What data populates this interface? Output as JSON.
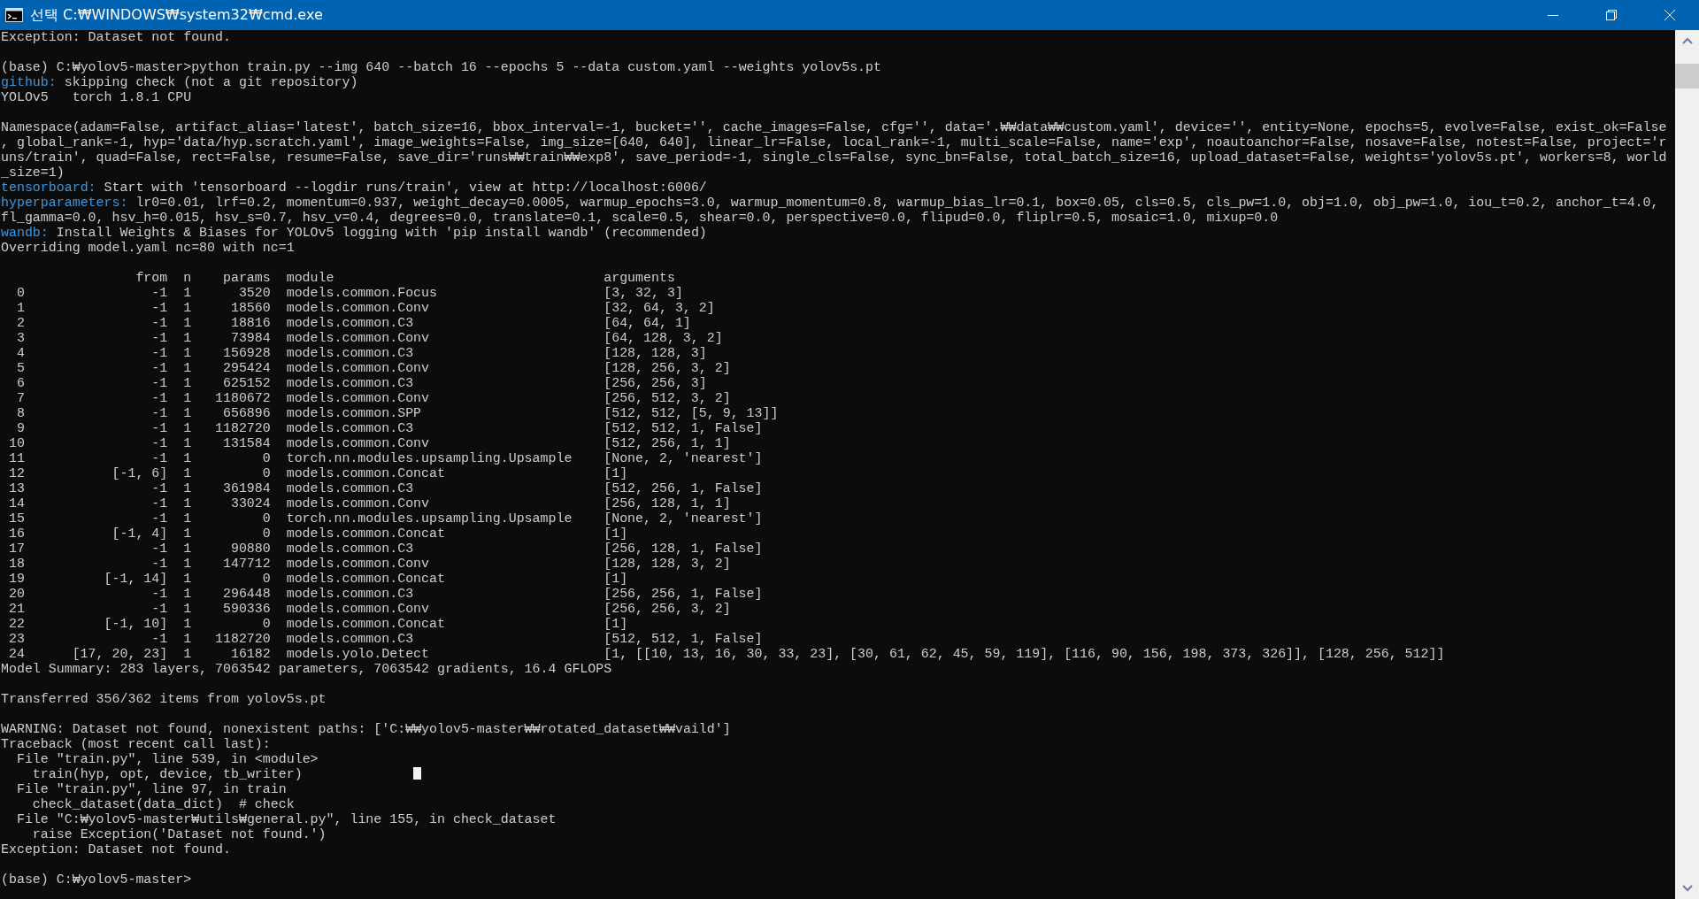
{
  "window": {
    "title": "선택 C:₩WINDOWS₩system32₩cmd.exe"
  },
  "console": {
    "lines": [
      {
        "kind": "text",
        "text": "Exception: Dataset not found."
      },
      {
        "kind": "blank"
      },
      {
        "kind": "text",
        "text": "(base) C:₩yolov5-master>python train.py --img 640 --batch 16 --epochs 5 --data custom.yaml --weights yolov5s.pt"
      },
      {
        "kind": "tagged",
        "tag": "github:",
        "text": "skipping check (not a git repository)"
      },
      {
        "kind": "text",
        "text": "YOLOv5   torch 1.8.1 CPU"
      },
      {
        "kind": "blank"
      },
      {
        "kind": "text",
        "text": "Namespace(adam=False, artifact_alias='latest', batch_size=16, bbox_interval=-1, bucket='', cache_images=False, cfg='', data='.₩₩data₩₩custom.yaml', device='', entity=None, epochs=5, evolve=False, exist_ok=False"
      },
      {
        "kind": "text",
        "text": ", global_rank=-1, hyp='data/hyp.scratch.yaml', image_weights=False, img_size=[640, 640], linear_lr=False, local_rank=-1, multi_scale=False, name='exp', noautoanchor=False, nosave=False, notest=False, project='r"
      },
      {
        "kind": "text",
        "text": "uns/train', quad=False, rect=False, resume=False, save_dir='runs₩₩train₩₩exp8', save_period=-1, single_cls=False, sync_bn=False, total_batch_size=16, upload_dataset=False, weights='yolov5s.pt', workers=8, world"
      },
      {
        "kind": "text",
        "text": "_size=1)"
      },
      {
        "kind": "tagged",
        "tag": "tensorboard:",
        "text": "Start with 'tensorboard --logdir runs/train', view at http://localhost:6006/"
      },
      {
        "kind": "tagged",
        "tag": "hyperparameters:",
        "text": "lr0=0.01, lrf=0.2, momentum=0.937, weight_decay=0.0005, warmup_epochs=3.0, warmup_momentum=0.8, warmup_bias_lr=0.1, box=0.05, cls=0.5, cls_pw=1.0, obj=1.0, obj_pw=1.0, iou_t=0.2, anchor_t=4.0,"
      },
      {
        "kind": "text",
        "text": "fl_gamma=0.0, hsv_h=0.015, hsv_s=0.7, hsv_v=0.4, degrees=0.0, translate=0.1, scale=0.5, shear=0.0, perspective=0.0, flipud=0.0, fliplr=0.5, mosaic=1.0, mixup=0.0"
      },
      {
        "kind": "tagged",
        "tag": "wandb:",
        "text": "Install Weights & Biases for YOLOv5 logging with 'pip install wandb' (recommended)"
      },
      {
        "kind": "text",
        "text": "Overriding model.yaml nc=80 with nc=1"
      },
      {
        "kind": "blank"
      },
      {
        "kind": "table",
        "columns": [
          "",
          "from",
          "n",
          "params",
          "module",
          "arguments"
        ],
        "rows": [
          [
            "0",
            "-1",
            "1",
            "3520",
            "models.common.Focus",
            "[3, 32, 3]"
          ],
          [
            "1",
            "-1",
            "1",
            "18560",
            "models.common.Conv",
            "[32, 64, 3, 2]"
          ],
          [
            "2",
            "-1",
            "1",
            "18816",
            "models.common.C3",
            "[64, 64, 1]"
          ],
          [
            "3",
            "-1",
            "1",
            "73984",
            "models.common.Conv",
            "[64, 128, 3, 2]"
          ],
          [
            "4",
            "-1",
            "1",
            "156928",
            "models.common.C3",
            "[128, 128, 3]"
          ],
          [
            "5",
            "-1",
            "1",
            "295424",
            "models.common.Conv",
            "[128, 256, 3, 2]"
          ],
          [
            "6",
            "-1",
            "1",
            "625152",
            "models.common.C3",
            "[256, 256, 3]"
          ],
          [
            "7",
            "-1",
            "1",
            "1180672",
            "models.common.Conv",
            "[256, 512, 3, 2]"
          ],
          [
            "8",
            "-1",
            "1",
            "656896",
            "models.common.SPP",
            "[512, 512, [5, 9, 13]]"
          ],
          [
            "9",
            "-1",
            "1",
            "1182720",
            "models.common.C3",
            "[512, 512, 1, False]"
          ],
          [
            "10",
            "-1",
            "1",
            "131584",
            "models.common.Conv",
            "[512, 256, 1, 1]"
          ],
          [
            "11",
            "-1",
            "1",
            "0",
            "torch.nn.modules.upsampling.Upsample",
            "[None, 2, 'nearest']"
          ],
          [
            "12",
            "[-1, 6]",
            "1",
            "0",
            "models.common.Concat",
            "[1]"
          ],
          [
            "13",
            "-1",
            "1",
            "361984",
            "models.common.C3",
            "[512, 256, 1, False]"
          ],
          [
            "14",
            "-1",
            "1",
            "33024",
            "models.common.Conv",
            "[256, 128, 1, 1]"
          ],
          [
            "15",
            "-1",
            "1",
            "0",
            "torch.nn.modules.upsampling.Upsample",
            "[None, 2, 'nearest']"
          ],
          [
            "16",
            "[-1, 4]",
            "1",
            "0",
            "models.common.Concat",
            "[1]"
          ],
          [
            "17",
            "-1",
            "1",
            "90880",
            "models.common.C3",
            "[256, 128, 1, False]"
          ],
          [
            "18",
            "-1",
            "1",
            "147712",
            "models.common.Conv",
            "[128, 128, 3, 2]"
          ],
          [
            "19",
            "[-1, 14]",
            "1",
            "0",
            "models.common.Concat",
            "[1]"
          ],
          [
            "20",
            "-1",
            "1",
            "296448",
            "models.common.C3",
            "[256, 256, 1, False]"
          ],
          [
            "21",
            "-1",
            "1",
            "590336",
            "models.common.Conv",
            "[256, 256, 3, 2]"
          ],
          [
            "22",
            "[-1, 10]",
            "1",
            "0",
            "models.common.Concat",
            "[1]"
          ],
          [
            "23",
            "-1",
            "1",
            "1182720",
            "models.common.C3",
            "[512, 512, 1, False]"
          ],
          [
            "24",
            "[17, 20, 23]",
            "1",
            "16182",
            "models.yolo.Detect",
            "[1, [[10, 13, 16, 30, 33, 23], [30, 61, 62, 45, 59, 119], [116, 90, 156, 198, 373, 326]], [128, 256, 512]]"
          ]
        ]
      },
      {
        "kind": "text",
        "text": "Model Summary: 283 layers, 7063542 parameters, 7063542 gradients, 16.4 GFLOPS"
      },
      {
        "kind": "blank"
      },
      {
        "kind": "text",
        "text": "Transferred 356/362 items from yolov5s.pt"
      },
      {
        "kind": "blank"
      },
      {
        "kind": "text",
        "text": "WARNING: Dataset not found, nonexistent paths: ['C:₩₩yolov5-master₩₩rotated_dataset₩₩vaild']"
      },
      {
        "kind": "text",
        "text": "Traceback (most recent call last):"
      },
      {
        "kind": "text",
        "text": "  File \"train.py\", line 539, in <module>"
      },
      {
        "kind": "text",
        "text": "    train(hyp, opt, device, tb_writer)",
        "cursor": true
      },
      {
        "kind": "text",
        "text": "  File \"train.py\", line 97, in train"
      },
      {
        "kind": "text",
        "text": "    check_dataset(data_dict)  # check"
      },
      {
        "kind": "text",
        "text": "  File \"C:₩yolov5-master₩utils₩general.py\", line 155, in check_dataset"
      },
      {
        "kind": "text",
        "text": "    raise Exception('Dataset not found.')"
      },
      {
        "kind": "text",
        "text": "Exception: Dataset not found."
      },
      {
        "kind": "blank"
      },
      {
        "kind": "text",
        "text": "(base) C:₩yolov5-master>"
      }
    ]
  }
}
